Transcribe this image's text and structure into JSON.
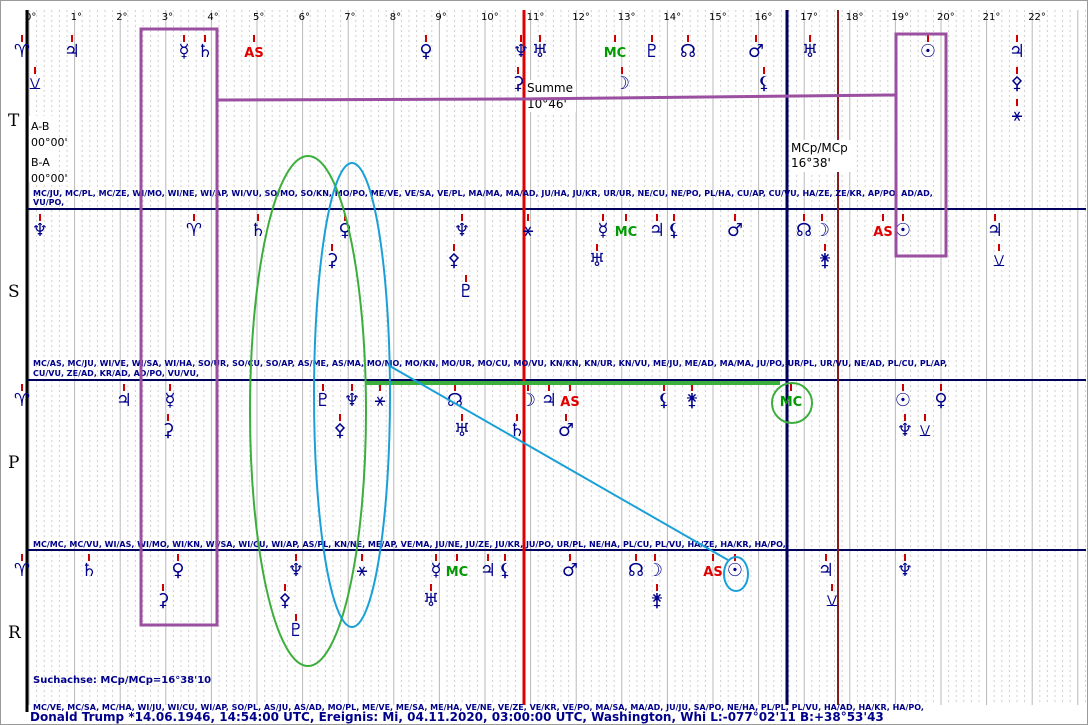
{
  "degree_labels": [
    "0°",
    "1°",
    "2°",
    "3°",
    "4°",
    "5°",
    "6°",
    "7°",
    "8°",
    "9°",
    "10°",
    "11°",
    "12°",
    "13°",
    "14°",
    "15°",
    "16°",
    "17°",
    "18°",
    "19°",
    "20°",
    "21°",
    "22°"
  ],
  "rows": [
    "T",
    "S",
    "P",
    "R"
  ],
  "ab_labels": {
    "ab": "A-B",
    "ab_val": "00°00'",
    "ba": "B-A",
    "ba_val": "00°00'"
  },
  "summe": {
    "label": "Summe",
    "value": "10°46'"
  },
  "mcp": {
    "label": "MCp/MCp",
    "value": "16°38'"
  },
  "midpoint_lines": {
    "t1": "MC/JU, MC/PL, MC/ZE, WI/MO, WI/NE, WI/AP, WI/VU, SO/MO, SO/KN, MO/PO, ME/VE, VE/SA, VE/PL, MA/MA, MA/AD, JU/HA, JU/KR, UR/UR, NE/CU, NE/PO, PL/HA, CU/AP, CU/VU, HA/ZE, ZE/KR, AP/PO, AD/AD,",
    "t2": "VU/PO,",
    "s1": "MC/AS, MC/JU, WI/VE, WI/SA, WI/HA, SO/UR, SO/CU, SO/AP, AS/ME, AS/MA, MO/MO, MO/KN, MO/UR, MO/CU, MO/VU, KN/KN, KN/UR, KN/VU, ME/JU, ME/AD, MA/MA, JU/PO, UR/PL, UR/VU, NE/AD, PL/CU, PL/AP,",
    "s2": "CU/VU, ZE/AD, KR/AD, AD/PO, VU/VU,",
    "p1": "MC/MC, MC/VU, WI/AS, WI/MO, WI/KN, WI/SA, WI/CU, WI/AP, AS/PL, KN/NE, ME/AP, VE/MA, JU/NE, JU/ZE, JU/KR, JU/PO, UR/PL, NE/HA, PL/CU, PL/VU, HA/ZE, HA/KR, HA/PO,",
    "r1": "MC/VE, MC/SA, MC/HA, WI/JU, WI/CU, WI/AP, SO/PL, AS/JU, AS/AD, MO/PL, ME/VE, ME/SA, ME/HA, VE/NE, VE/ZE, VE/KR, VE/PO, MA/SA, MA/AD, JU/JU, SA/PO, NE/HA, PL/PL, PL/VU, HA/AD, HA/KR, HA/PO,"
  },
  "search_axis": "Suchachse: MCp/MCp=16°38'10",
  "footer": "Donald Trump  *14.06.1946, 14:54:00 UTC, Ereignis: Mi, 04.11.2020, 03:00:00 UTC, Washington, Whi L:-077°02'11 B:+38°53'43",
  "glyphs": {
    "aries": "♈",
    "jupiter": "♃",
    "mercury": "☿",
    "saturn": "♄",
    "venus": "♀",
    "uranus": "♅",
    "neptune": "♆",
    "mars": "♂",
    "sun": "☉",
    "pluto": "♇",
    "moon": "☽",
    "node": "☊",
    "as": "AS",
    "mc": "MC",
    "cupido": "⚳",
    "hades": "⚴",
    "zeus": "⚵",
    "kronos": "⚶",
    "apollon": "⚷",
    "admetos": "⚸",
    "vulkanus": "⚹",
    "poseidon": "⚺",
    "cross": "⚳"
  },
  "colors": {
    "glyph": "#00008b",
    "red": "#e00000",
    "green": "#009a00",
    "purple": "#9b4fa0",
    "cyan": "#1aa0d8",
    "green_hl": "#3cae3c",
    "redline": "#e00000",
    "darkred": "#8b1a1a",
    "navy": "#00005e"
  }
}
